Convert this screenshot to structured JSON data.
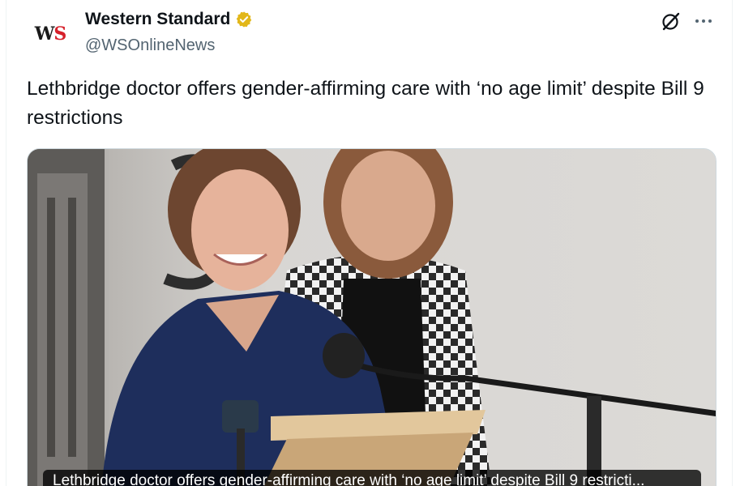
{
  "author": {
    "avatar_text_main": "W",
    "avatar_text_accent": "S",
    "display_name": "Western Standard",
    "handle": "@WSOnlineNews",
    "verified": true,
    "verified_color": "#e2b719"
  },
  "actions": {
    "grok_icon": "grok-icon",
    "more_icon": "more-icon"
  },
  "tweet": {
    "text": "Lethbridge doctor offers gender-affirming care with ‘no age limit’ despite Bill 9 restrictions"
  },
  "media": {
    "caption": "Lethbridge doctor offers gender-affirming care with ‘no age limit’ despite Bill 9 restricti..."
  },
  "colors": {
    "text_primary": "#0f1419",
    "text_secondary": "#536471",
    "brand_red": "#d6202a",
    "border": "#cfd9de"
  }
}
